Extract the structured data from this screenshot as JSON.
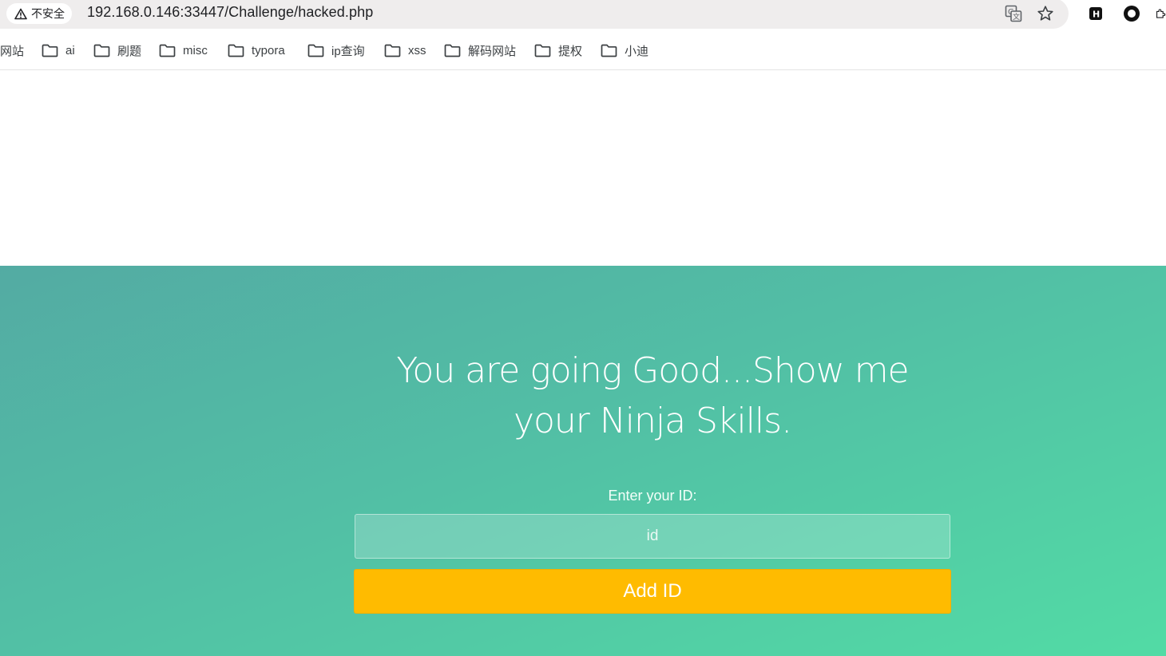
{
  "browser": {
    "security_label": "不安全",
    "url": "192.168.0.146:33447/Challenge/hacked.php",
    "icons": [
      "warning-triangle-icon",
      "translate-icon",
      "bookmark-star-icon",
      "extension-h-icon",
      "extension-circle-icon",
      "extension-puzzle-icon"
    ]
  },
  "bookmarks": [
    {
      "label": "网站",
      "icon": ""
    },
    {
      "label": "ai",
      "icon": "folder-icon"
    },
    {
      "label": "刷题",
      "icon": "folder-icon"
    },
    {
      "label": "misc",
      "icon": "folder-icon"
    },
    {
      "label": "typora",
      "icon": "folder-icon"
    },
    {
      "label": "ip查询",
      "icon": "folder-icon"
    },
    {
      "label": "xss",
      "icon": "folder-icon"
    },
    {
      "label": "解码网站",
      "icon": "folder-icon"
    },
    {
      "label": "提权",
      "icon": "folder-icon"
    },
    {
      "label": "小迪",
      "icon": "folder-icon"
    }
  ],
  "page": {
    "title": "You are going Good...Show me your Ninja Skills.",
    "id_label": "Enter your ID:",
    "id_placeholder": "id",
    "id_value": "",
    "submit_label": "Add ID"
  },
  "colors": {
    "gradient_start": "#53aba3",
    "gradient_end": "#52dba5",
    "button": "#ffbb00"
  }
}
